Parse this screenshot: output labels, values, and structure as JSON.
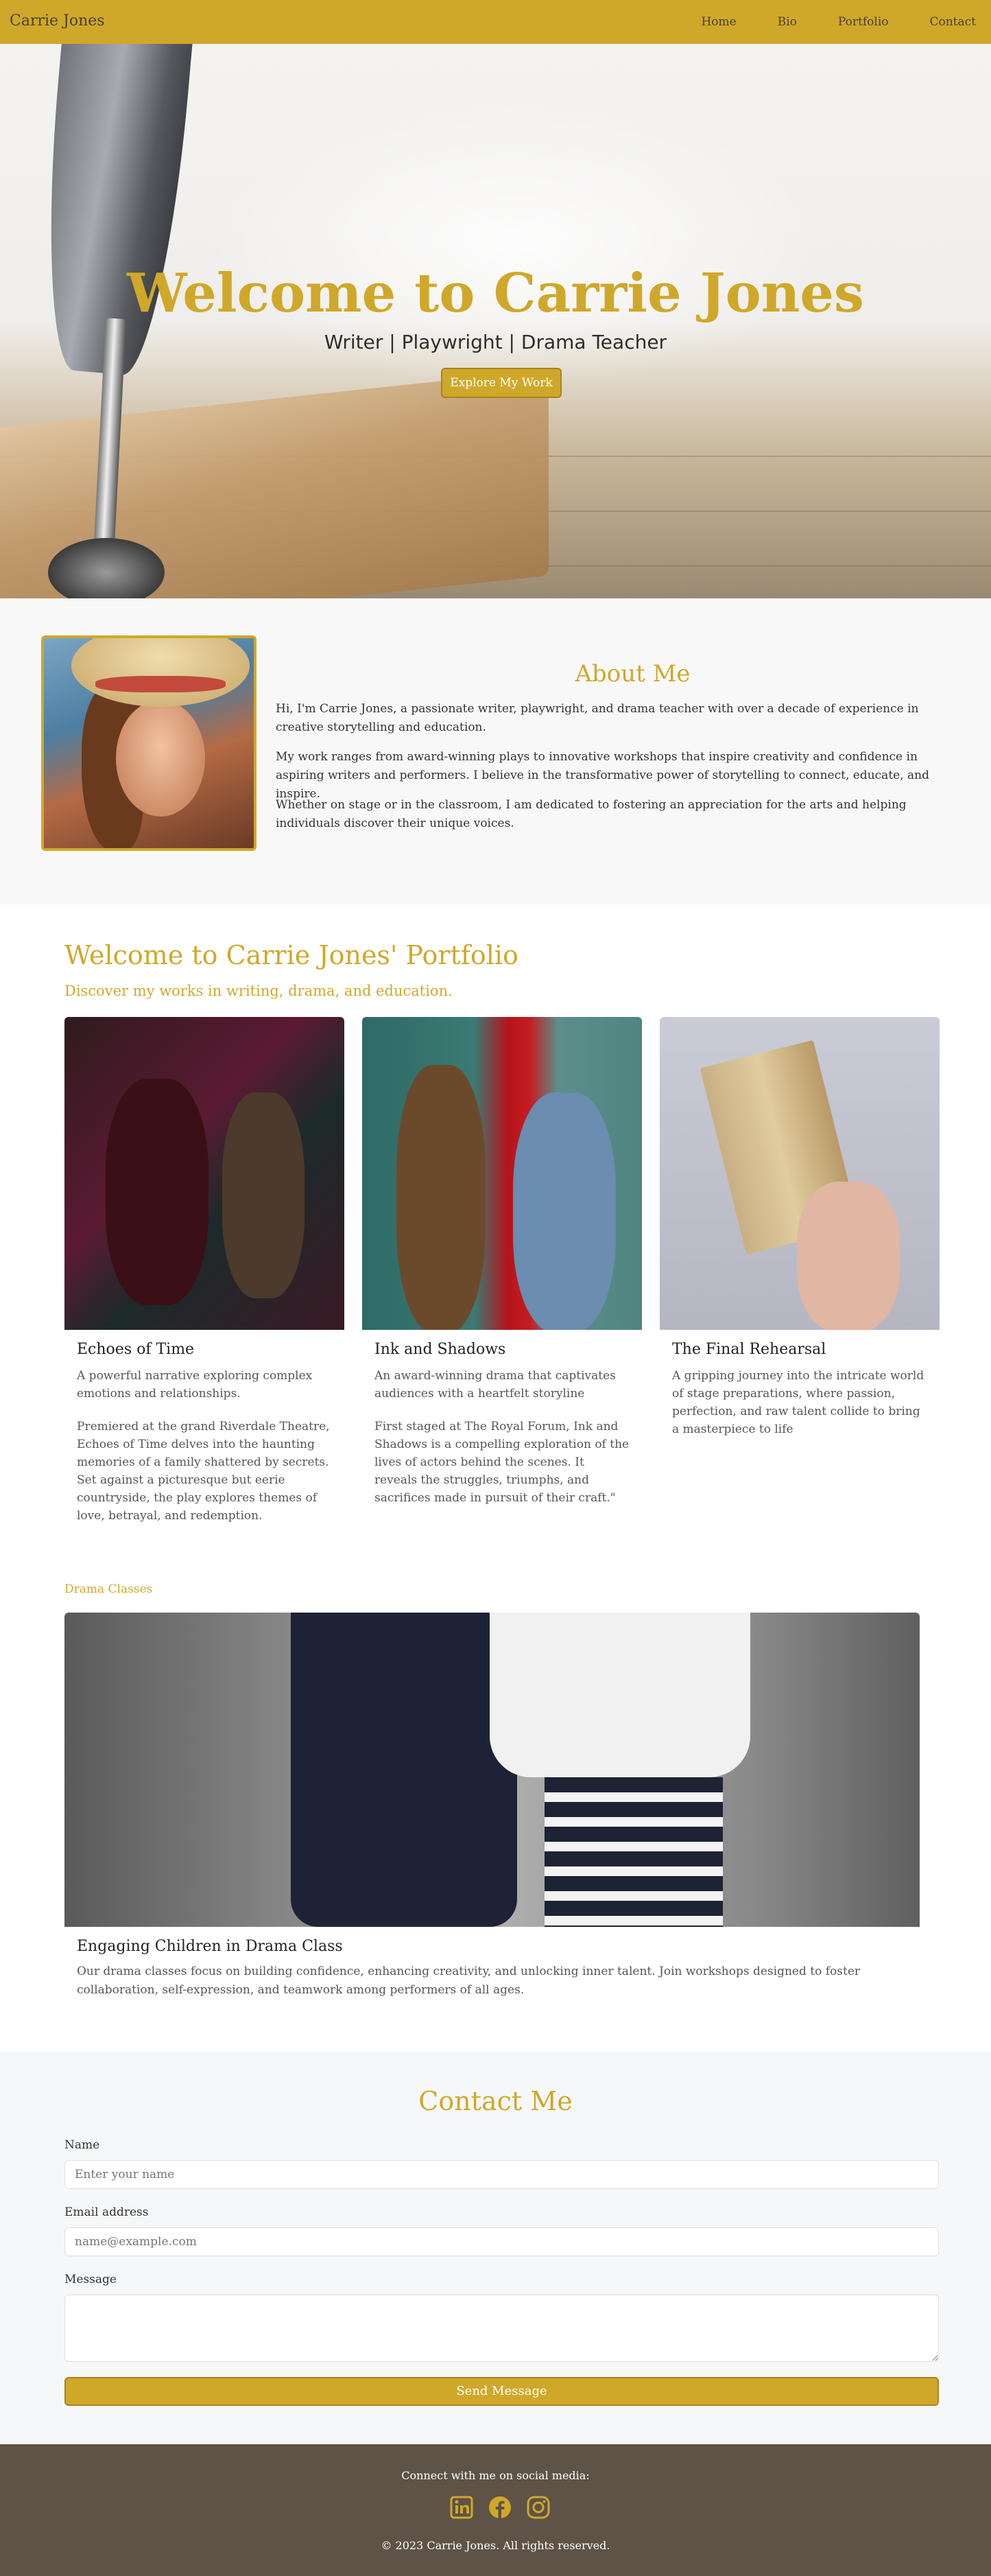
{
  "nav": {
    "brand": "Carrie Jones",
    "links": [
      "Home",
      "Bio",
      "Portfolio",
      "Contact"
    ]
  },
  "hero": {
    "title": "Welcome to Carrie Jones",
    "subtitle": "Writer | Playwright | Drama Teacher",
    "button": "Explore My Work"
  },
  "about": {
    "title": "About Me",
    "paragraphs": [
      "Hi, I'm Carrie Jones, a passionate writer, playwright, and drama teacher with over a decade of experience in creative storytelling and education.",
      "My work ranges from award-winning plays to innovative workshops that inspire creativity and confidence in aspiring writers and performers. I believe in the transformative power of storytelling to connect, educate, and inspire.",
      "Whether on stage or in the classroom, I am dedicated to fostering an appreciation for the arts and helping individuals discover their unique voices."
    ]
  },
  "portfolio": {
    "title": "Welcome to Carrie Jones' Portfolio",
    "subtitle": "Discover my works in writing, drama, and education.",
    "cards": [
      {
        "title": "Echoes of Time",
        "summary": "A powerful narrative exploring complex emotions and relationships.",
        "detail": "Premiered at the grand Riverdale Theatre, Echoes of Time delves into the haunting memories of a family shattered by secrets. Set against a picturesque but eerie countryside, the play explores themes of love, betrayal, and redemption."
      },
      {
        "title": "Ink and Shadows",
        "summary": "An award-winning drama that captivates audiences with a heartfelt storyline",
        "detail": "First staged at The Royal Forum, Ink and Shadows is a compelling exploration of the lives of actors behind the scenes. It reveals the struggles, triumphs, and sacrifices made in pursuit of their craft.\""
      },
      {
        "title": "The Final Rehearsal",
        "summary": "A gripping journey into the intricate world of stage preparations, where passion, perfection, and raw talent collide to bring a masterpiece to life",
        "detail": ""
      }
    ]
  },
  "drama": {
    "label": "Drama Classes",
    "title": "Engaging Children in Drama Class",
    "description": "Our drama classes focus on building confidence, enhancing creativity, and unlocking inner talent. Join workshops designed to foster collaboration, self-expression, and teamwork among performers of all ages."
  },
  "contact": {
    "title": "Contact Me",
    "name_label": "Name",
    "name_placeholder": "Enter your name",
    "email_label": "Email address",
    "email_placeholder": "name@example.com",
    "message_label": "Message",
    "button": "Send Message"
  },
  "footer": {
    "connect": "Connect with me on social media:",
    "icons": [
      "linkedin-icon",
      "facebook-icon",
      "instagram-icon"
    ],
    "copyright": "© 2023 Carrie Jones. All rights reserved."
  },
  "colors": {
    "accent": "#cfa82a",
    "footer_bg": "#5e5346",
    "section_bg": "#f8f8f8"
  }
}
